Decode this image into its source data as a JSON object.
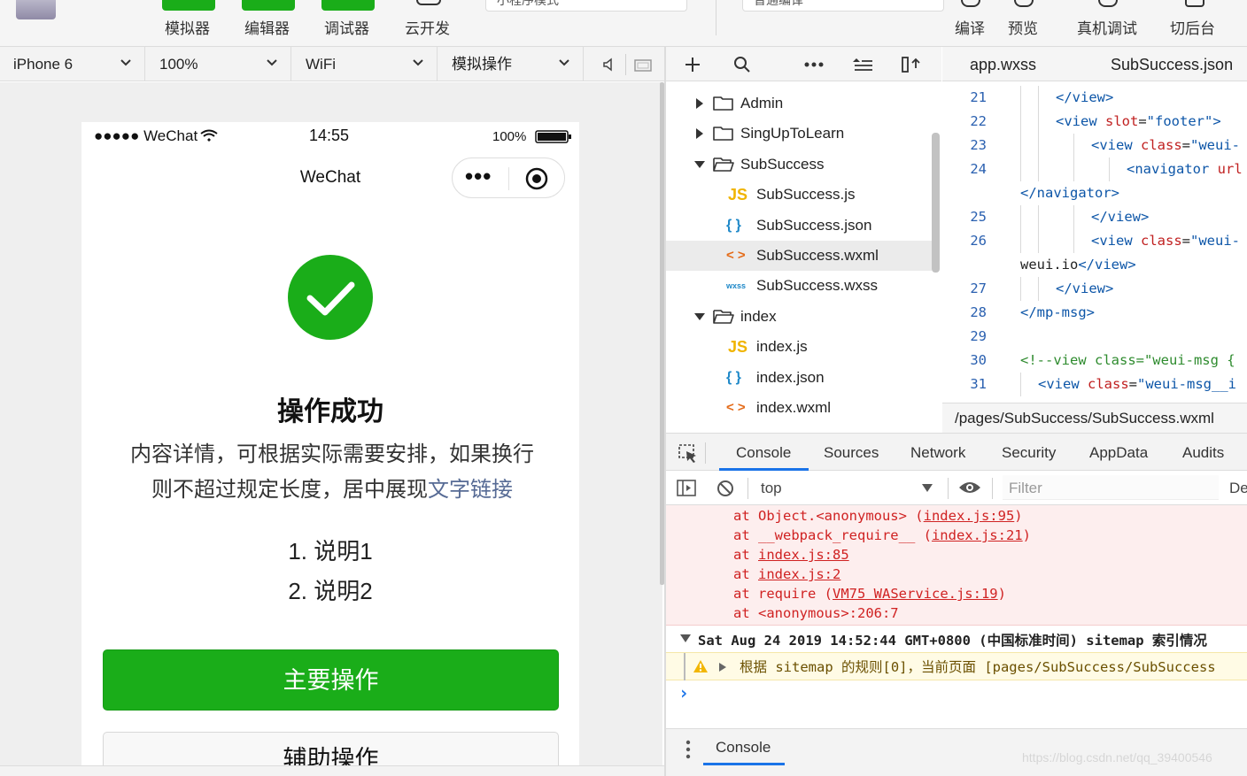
{
  "toolbar": {
    "groups": [
      "模拟器",
      "编辑器",
      "调试器",
      "云开发"
    ],
    "actions": [
      "编译",
      "预览",
      "真机调试",
      "切后台"
    ],
    "mode_select": "小程序模式",
    "compile_select": "普通编译"
  },
  "simulator_bar": {
    "device": "iPhone 6",
    "zoom": "100%",
    "network": "WiFi",
    "operation": "模拟操作"
  },
  "phone": {
    "carrier": "●●●●● WeChat",
    "time": "14:55",
    "battery": "100%",
    "nav_title": "WeChat",
    "menu_dots": "•••",
    "success_title": "操作成功",
    "desc_text": "内容详情，可根据实际需要安排，如果换行则不超过规定长度，居中展现",
    "desc_link": "文字链接",
    "notes": [
      "1. 说明1",
      "2. 说明2"
    ],
    "primary_button": "主要操作",
    "secondary_button": "辅助操作"
  },
  "file_tree": [
    {
      "label": "Admin",
      "type": "folder",
      "open": false
    },
    {
      "label": "SingUpToLearn",
      "type": "folder",
      "open": false
    },
    {
      "label": "SubSuccess",
      "type": "folder",
      "open": true
    },
    {
      "label": "SubSuccess.js",
      "type": "js",
      "badge": "JS"
    },
    {
      "label": "SubSuccess.json",
      "type": "json",
      "badge": "{ }"
    },
    {
      "label": "SubSuccess.wxml",
      "type": "wxml",
      "badge": "< >",
      "selected": true
    },
    {
      "label": "SubSuccess.wxss",
      "type": "wxss",
      "badge": "wxss"
    },
    {
      "label": "index",
      "type": "folder",
      "open": true
    },
    {
      "label": "index.js",
      "type": "js",
      "badge": "JS"
    },
    {
      "label": "index.json",
      "type": "json",
      "badge": "{ }"
    },
    {
      "label": "index.wxml",
      "type": "wxml",
      "badge": "< >"
    }
  ],
  "editor_tabs": [
    "app.wxss",
    "SubSuccess.json"
  ],
  "code_lines": [
    {
      "n": "21",
      "parts": [
        [
          "tag",
          "</view>"
        ]
      ]
    },
    {
      "n": "22",
      "parts": [
        [
          "tag",
          "<view "
        ],
        [
          "attr",
          "slot"
        ],
        [
          "plain",
          "="
        ],
        [
          "str",
          "\"footer\""
        ],
        [
          "tag",
          ">"
        ]
      ]
    },
    {
      "n": "23",
      "parts": [
        [
          "tag",
          "<view "
        ],
        [
          "attr",
          "class"
        ],
        [
          "plain",
          "="
        ],
        [
          "str",
          "\"weui-"
        ]
      ]
    },
    {
      "n": "24",
      "parts": [
        [
          "tag",
          "<navigator "
        ],
        [
          "attr",
          "url"
        ]
      ]
    },
    {
      "n": "",
      "parts": [
        [
          "tag",
          "</navigator>"
        ]
      ]
    },
    {
      "n": "25",
      "parts": [
        [
          "tag",
          "</view>"
        ]
      ]
    },
    {
      "n": "26",
      "parts": [
        [
          "tag",
          "<view "
        ],
        [
          "attr",
          "class"
        ],
        [
          "plain",
          "="
        ],
        [
          "str",
          "\"weui-"
        ]
      ]
    },
    {
      "n": "",
      "parts": [
        [
          "plain",
          "weui.io"
        ],
        [
          "tag",
          "</view>"
        ]
      ]
    },
    {
      "n": "27",
      "parts": [
        [
          "tag",
          "</view>"
        ]
      ]
    },
    {
      "n": "28",
      "parts": [
        [
          "tag",
          "</mp-msg>"
        ]
      ]
    },
    {
      "n": "29",
      "parts": []
    },
    {
      "n": "30",
      "parts": [
        [
          "cm",
          "<!--view class=\"weui-msg {"
        ]
      ]
    },
    {
      "n": "31",
      "parts": [
        [
          "tag",
          "<view "
        ],
        [
          "attr",
          "class"
        ],
        [
          "plain",
          "="
        ],
        [
          "str",
          "\"weui-msg__i"
        ]
      ]
    }
  ],
  "editor_path": "/pages/SubSuccess/SubSuccess.wxml",
  "devtools": {
    "tabs": [
      "Console",
      "Sources",
      "Network",
      "Security",
      "AppData",
      "Audits"
    ],
    "context": "top",
    "filter_placeholder": "Filter",
    "default_levels": "De",
    "stack": [
      {
        "prefix": "at ",
        "fn": "Object.<anonymous> (",
        "link": "index.js:95",
        "suffix": ")"
      },
      {
        "prefix": "at ",
        "fn": "__webpack_require__ (",
        "link": "index.js:21",
        "suffix": ")"
      },
      {
        "prefix": "at ",
        "fn": "",
        "link": "index.js:85",
        "suffix": ""
      },
      {
        "prefix": "at ",
        "fn": "",
        "link": "index.js:2",
        "suffix": ""
      },
      {
        "prefix": "at ",
        "fn": "require (",
        "link": "VM75 WAService.js:19",
        "suffix": ")"
      },
      {
        "prefix": "at ",
        "fn": "<anonymous>:206:7",
        "link": "",
        "suffix": ""
      }
    ],
    "group_header": "Sat Aug 24 2019 14:52:44 GMT+0800 (中国标准时间) sitemap 索引情况",
    "warning": "根据 sitemap 的规则[0]，当前页面 [pages/SubSuccess/SubSuccess",
    "prompt": "›",
    "drawer_tab": "Console"
  },
  "watermark": "https://blog.csdn.net/qq_39400546",
  "colors": {
    "wechat_green": "#1aad19",
    "link": "#576b95",
    "error_bg": "#fdeeee",
    "warning_bg": "#fffbe5"
  }
}
